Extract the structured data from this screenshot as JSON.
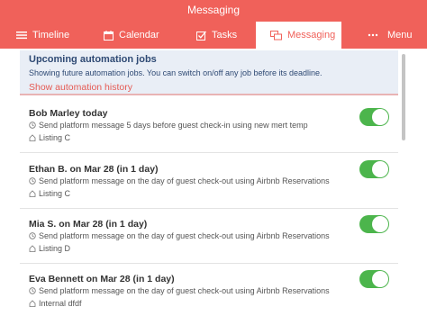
{
  "window": {
    "title": "Messaging"
  },
  "tabs": [
    {
      "label": "Timeline",
      "icon": "list-icon",
      "active": false
    },
    {
      "label": "Calendar",
      "icon": "calendar-icon",
      "active": false
    },
    {
      "label": "Tasks",
      "icon": "checkbox-icon",
      "active": false
    },
    {
      "label": "Messaging",
      "icon": "messages-icon",
      "active": true
    },
    {
      "label": "Menu",
      "icon": "more-icon",
      "active": false
    }
  ],
  "banner": {
    "heading": "Upcoming automation jobs",
    "subtext": "Showing future automation jobs. You can switch on/off any job before its deadline.",
    "link": "Show automation history"
  },
  "jobs": [
    {
      "title": "Bob Marley today",
      "message": "Send platform message 5 days before guest check-in using new mert temp",
      "listing": "Listing C",
      "enabled": true
    },
    {
      "title": "Ethan B. on Mar 28 (in 1 day)",
      "message": "Send platform message on the day of guest check-out using Airbnb Reservations",
      "listing": "Listing C",
      "enabled": true
    },
    {
      "title": "Mia S. on Mar 28 (in 1 day)",
      "message": "Send platform message on the day of guest check-out using Airbnb Reservations",
      "listing": "Listing D",
      "enabled": true
    },
    {
      "title": "Eva Bennett on Mar 28 (in 1 day)",
      "message": "Send platform message on the day of guest check-out using Airbnb Reservations",
      "listing": "Internal dfdf",
      "enabled": true
    }
  ],
  "colors": {
    "accent": "#f0615a",
    "toggle_on": "#4cb54c",
    "banner_bg": "#e9eef6",
    "banner_text": "#2f4a74"
  }
}
